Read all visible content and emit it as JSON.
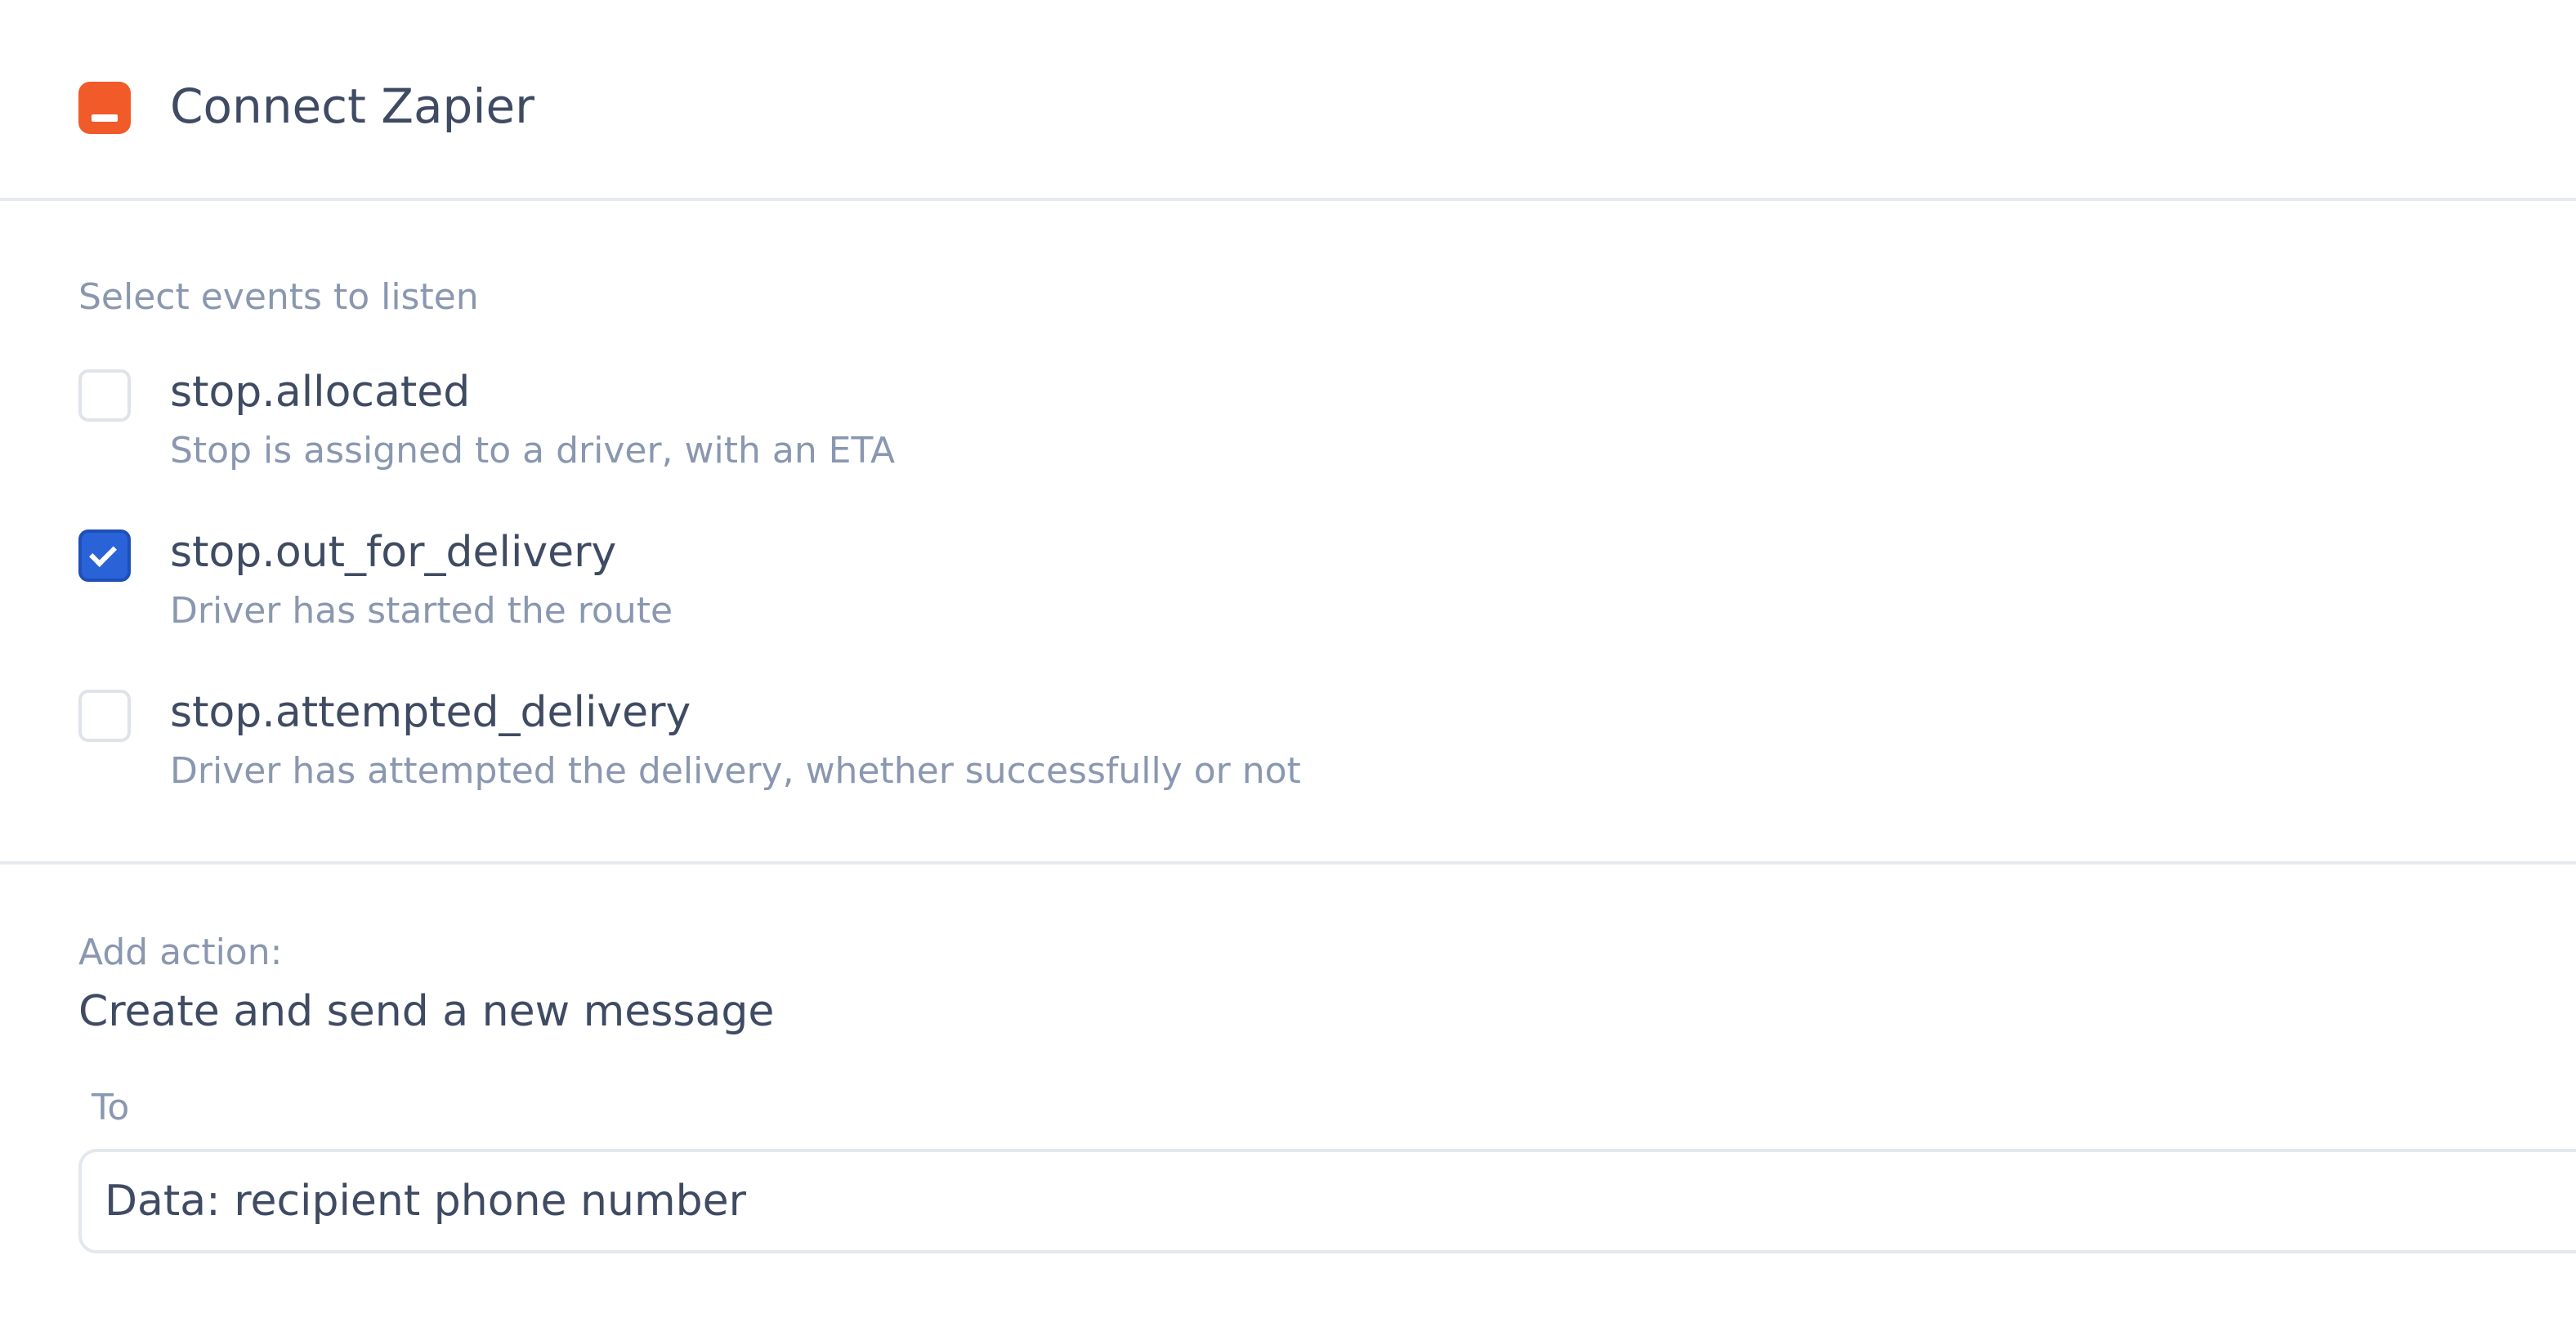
{
  "header": {
    "title": "Connect Zapier",
    "icon": "zapier-logo-icon",
    "icon_color": "#f15a29"
  },
  "events": {
    "label": "Select events to listen",
    "items": [
      {
        "name": "stop.allocated",
        "description": "Stop is assigned to a driver, with an ETA",
        "checked": false
      },
      {
        "name": "stop.out_for_delivery",
        "description": "Driver has started the route",
        "checked": true
      },
      {
        "name": "stop.attempted_delivery",
        "description": "Driver has attempted the delivery, whether successfully or not",
        "checked": false
      }
    ]
  },
  "action": {
    "label": "Add action:",
    "title": "Create and send a new message",
    "to_label": "To",
    "to_value": "Data: recipient phone number"
  },
  "colors": {
    "accent": "#2a62d8",
    "text": "#3f4b63",
    "muted": "#8a97b0",
    "divider": "#e6e9ef"
  }
}
